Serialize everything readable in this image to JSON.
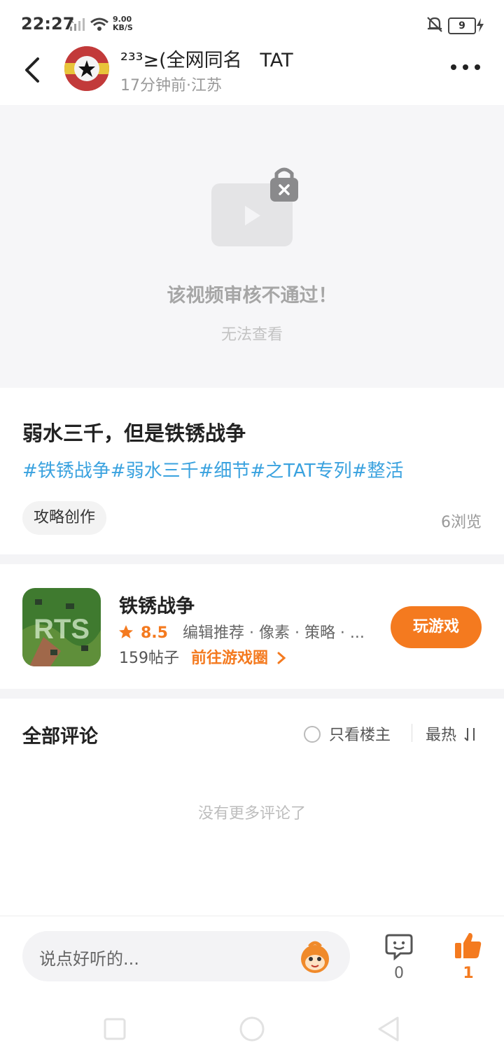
{
  "status_bar": {
    "time": "22:27",
    "net_speed_value": "9.00",
    "net_speed_unit": "KB/S",
    "battery": "9"
  },
  "header": {
    "username": "²³³≥(全网同名   TAT",
    "meta": "17分钟前·江苏"
  },
  "video": {
    "title": "该视频审核不通过！",
    "subtitle": "无法查看"
  },
  "post": {
    "title": "弱水三千，但是铁锈战争",
    "tags": "#铁锈战争#弱水三千#细节#之TAT专列#整活",
    "category": "攻略创作",
    "views": "6浏览"
  },
  "game": {
    "icon_text": "RTS",
    "name": "铁锈战争",
    "rating": "8.5",
    "tags": "编辑推荐 · 像素 · 策略 · ...",
    "posts": "159帖子",
    "goto": "前往游戏圈",
    "play_label": "玩游戏"
  },
  "comments": {
    "title": "全部评论",
    "only_op": "只看楼主",
    "sort": "最热",
    "no_more": "没有更多评论了"
  },
  "bottom": {
    "input_placeholder": "说点好听的...",
    "comment_count": "0",
    "like_count": "1"
  },
  "colors": {
    "accent": "#f47a1f",
    "tag_blue": "#3aa2df"
  }
}
